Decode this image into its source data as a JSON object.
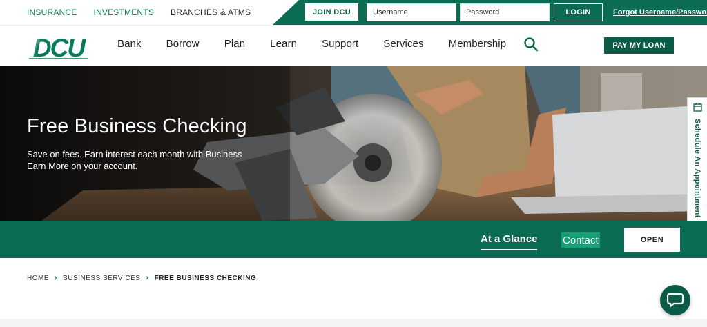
{
  "utility": {
    "links": [
      {
        "label": "INSURANCE"
      },
      {
        "label": "INVESTMENTS"
      },
      {
        "label": "BRANCHES & ATMS"
      }
    ],
    "join_label": "JOIN DCU",
    "username_placeholder": "Username",
    "password_placeholder": "Password",
    "login_label": "LOGIN",
    "forgot_label": "Forgot Username/Password"
  },
  "nav": {
    "logo_text": "DCU",
    "items": [
      {
        "label": "Bank"
      },
      {
        "label": "Borrow"
      },
      {
        "label": "Plan"
      },
      {
        "label": "Learn"
      },
      {
        "label": "Support"
      },
      {
        "label": "Services"
      },
      {
        "label": "Membership"
      }
    ],
    "search_icon": "search-icon",
    "pay_label": "PAY MY LOAN"
  },
  "hero": {
    "title": "Free Business Checking",
    "subtitle": "Save on fees. Earn interest each month with Business Earn More on your account.",
    "appointment_label": "Schedule An Appointment"
  },
  "subnav": {
    "glance_label": "At a Glance",
    "contact_label": "Contact",
    "open_label": "OPEN"
  },
  "breadcrumb": [
    {
      "label": "HOME"
    },
    {
      "label": "BUSINESS SERVICES"
    },
    {
      "label": "FREE BUSINESS CHECKING"
    }
  ],
  "colors": {
    "brand_green": "#0b6b53",
    "dark_green": "#0b5c47",
    "accent_green": "#17a075"
  }
}
